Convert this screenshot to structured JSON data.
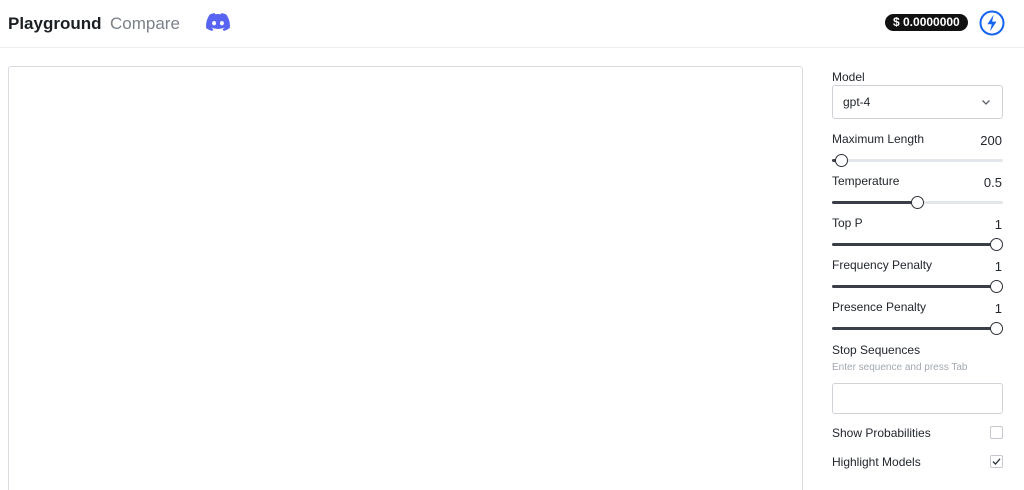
{
  "header": {
    "tabs": [
      {
        "label": "Playground",
        "active": true
      },
      {
        "label": "Compare",
        "active": false
      }
    ],
    "discord_icon": "discord-icon",
    "balance": "$ 0.0000000",
    "bolt_icon": "lightning-bolt-icon",
    "accent_color": "#1565f0"
  },
  "sidebar": {
    "model": {
      "label": "Model",
      "value": "gpt-4"
    },
    "params": [
      {
        "label": "Maximum Length",
        "value": "200",
        "fraction": 0.02
      },
      {
        "label": "Temperature",
        "value": "0.5",
        "fraction": 0.5
      },
      {
        "label": "Top P",
        "value": "1",
        "fraction": 1.0
      },
      {
        "label": "Frequency Penalty",
        "value": "1",
        "fraction": 1.0
      },
      {
        "label": "Presence Penalty",
        "value": "1",
        "fraction": 1.0
      }
    ],
    "stop_sequences": {
      "label": "Stop Sequences",
      "hint": "Enter sequence and press Tab",
      "value": ""
    },
    "show_probabilities": {
      "label": "Show Probabilities",
      "checked": false
    },
    "highlight_models": {
      "label": "Highlight Models",
      "checked": true
    }
  }
}
